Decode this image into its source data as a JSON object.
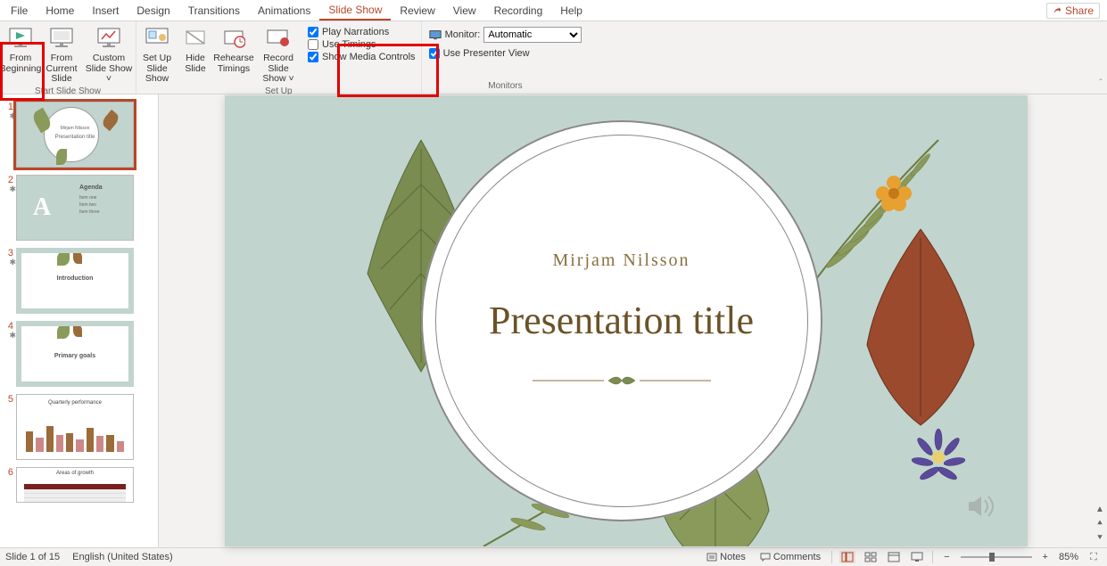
{
  "menubar": {
    "tabs": [
      "File",
      "Home",
      "Insert",
      "Design",
      "Transitions",
      "Animations",
      "Slide Show",
      "Review",
      "View",
      "Recording",
      "Help"
    ],
    "active": "Slide Show",
    "share": "Share"
  },
  "ribbon": {
    "groups": {
      "start_slide_show": {
        "label": "Start Slide Show",
        "buttons": {
          "from_beginning": "From Beginning",
          "from_current": "From Current Slide",
          "custom": "Custom Slide Show ˅"
        }
      },
      "set_up": {
        "label": "Set Up",
        "buttons": {
          "setup": "Set Up Slide Show",
          "hide": "Hide Slide",
          "rehearse": "Rehearse Timings",
          "record": "Record Slide Show ˅"
        },
        "checks": {
          "play_narrations": {
            "label": "Play Narrations",
            "checked": true
          },
          "use_timings": {
            "label": "Use Timings",
            "checked": false
          },
          "show_media": {
            "label": "Show Media Controls",
            "checked": true
          }
        }
      },
      "monitors": {
        "label": "Monitors",
        "monitor_label": "Monitor:",
        "monitor_value": "Automatic",
        "presenter_view": {
          "label": "Use Presenter View",
          "checked": true
        }
      }
    }
  },
  "thumbs": {
    "items": [
      {
        "num": "1",
        "star": true,
        "selected": true,
        "type": "title"
      },
      {
        "num": "2",
        "star": true,
        "type": "agenda",
        "title": "Agenda"
      },
      {
        "num": "3",
        "star": true,
        "type": "intro",
        "title": "Introduction"
      },
      {
        "num": "4",
        "star": true,
        "type": "goals",
        "title": "Primary goals"
      },
      {
        "num": "5",
        "type": "chart",
        "title": "Quarterly performance"
      },
      {
        "num": "6",
        "type": "table",
        "title": "Areas of growth"
      }
    ]
  },
  "slide": {
    "presenter": "Mirjam Nilsson",
    "title": "Presentation title"
  },
  "status": {
    "slide_of": "Slide 1 of 15",
    "language": "English (United States)",
    "notes": "Notes",
    "comments": "Comments",
    "zoom": "85%",
    "zoom_minus": "−",
    "zoom_plus": "+"
  },
  "icons": {
    "fit": "⛶"
  }
}
